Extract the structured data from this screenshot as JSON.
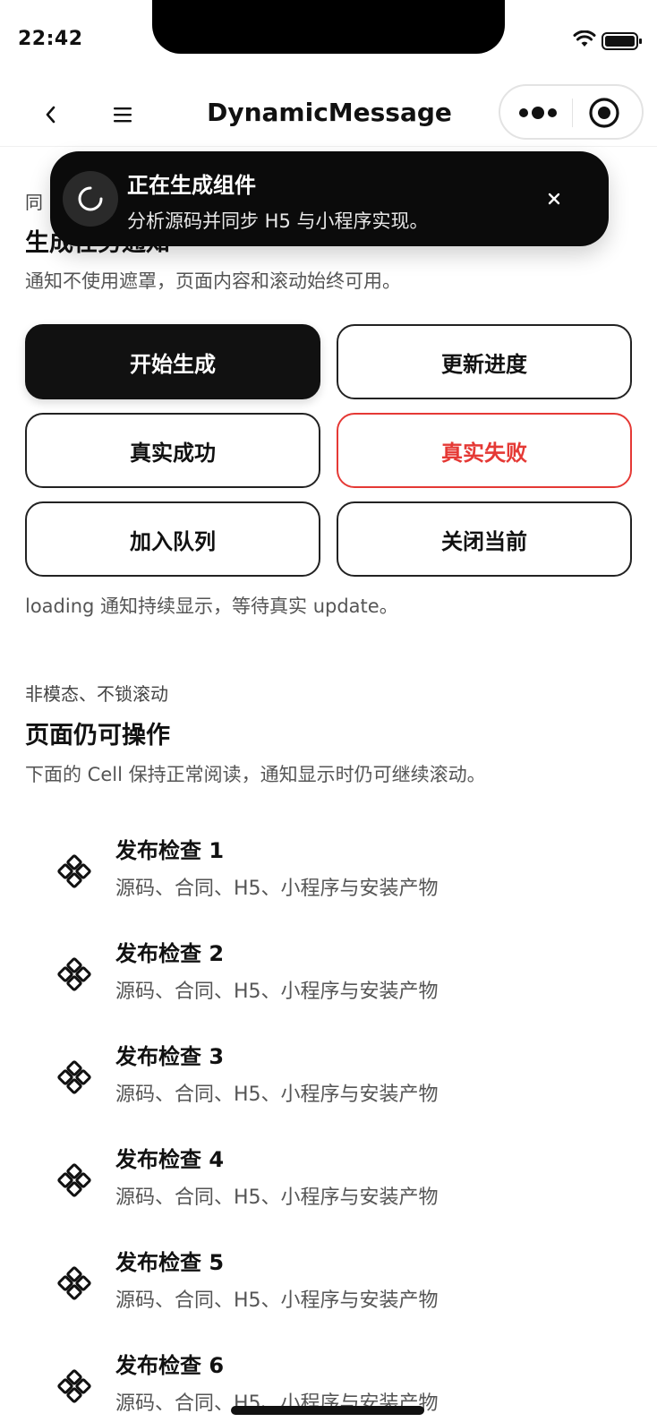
{
  "status_bar": {
    "time": "22:42"
  },
  "nav": {
    "title": "DynamicMessage"
  },
  "section1": {
    "eyebrow": "同",
    "title": "生成任务通知",
    "desc": "通知不使用遮罩，页面内容和滚动始终可用。",
    "buttons": [
      {
        "label": "开始生成"
      },
      {
        "label": "更新进度"
      },
      {
        "label": "真实成功"
      },
      {
        "label": "真实失败"
      },
      {
        "label": "加入队列"
      },
      {
        "label": "关闭当前"
      }
    ],
    "hint": "loading 通知持续显示，等待真实 update。"
  },
  "section2": {
    "eyebrow": "非模态、不锁滚动",
    "title": "页面仍可操作",
    "desc": "下面的 Cell 保持正常阅读，通知显示时仍可继续滚动。"
  },
  "cells": [
    {
      "title": "发布检查 1",
      "desc": "源码、合同、H5、小程序与安装产物",
      "icon": "diamond-dots-icon"
    },
    {
      "title": "发布检查 2",
      "desc": "源码、合同、H5、小程序与安装产物",
      "icon": "diamond-dots-icon"
    },
    {
      "title": "发布检查 3",
      "desc": "源码、合同、H5、小程序与安装产物",
      "icon": "diamond-dots-icon"
    },
    {
      "title": "发布检查 4",
      "desc": "源码、合同、H5、小程序与安装产物",
      "icon": "diamond-dots-icon"
    },
    {
      "title": "发布检查 5",
      "desc": "源码、合同、H5、小程序与安装产物",
      "icon": "diamond-dots-icon"
    },
    {
      "title": "发布检查 6",
      "desc": "源码、合同、H5、小程序与安装产物",
      "icon": "diamond-dots-icon"
    }
  ],
  "toast": {
    "title": "正在生成组件",
    "message": "分析源码并同步 H5 与小程序实现。"
  },
  "colors": {
    "primary": "#111111",
    "danger": "#e53935",
    "toast_bg": "#0b0b0b"
  }
}
